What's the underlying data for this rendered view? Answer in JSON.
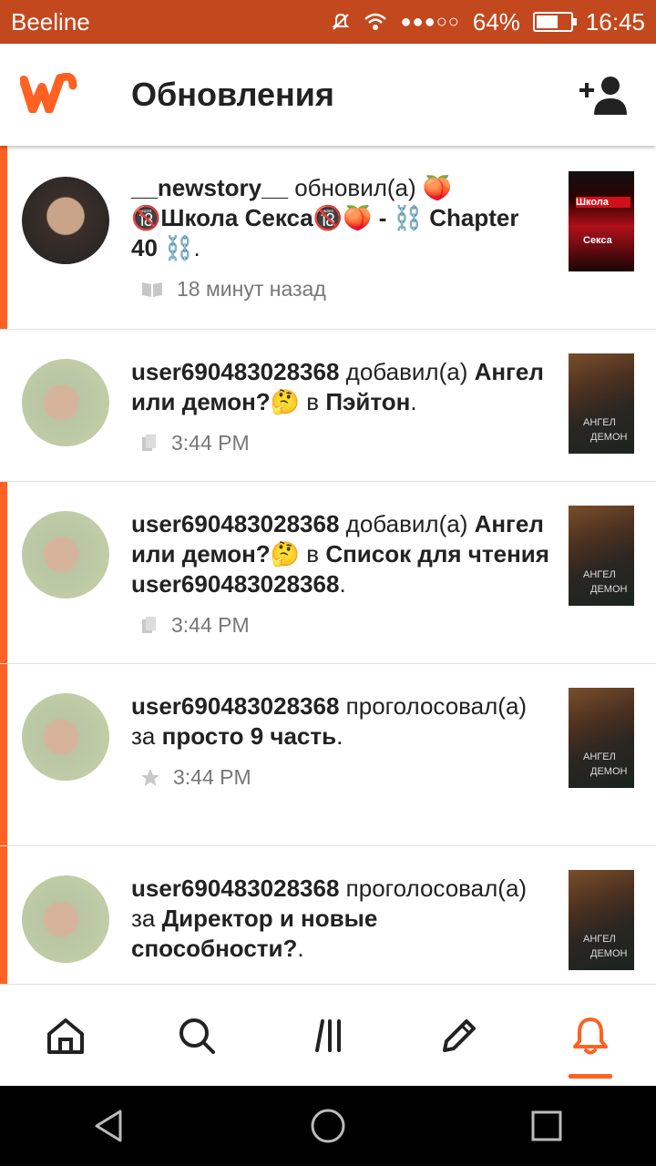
{
  "status_bar": {
    "carrier": "Beeline",
    "battery": "64%",
    "battery_level": 0.64,
    "time": "16:45"
  },
  "header": {
    "title": "Обновления"
  },
  "feed": [
    {
      "user": "__newstory__",
      "action": " обновил(а) 🍑",
      "target": "🔞Школа Секса🔞🍑 - ⛓️ Chapter 40 ⛓️",
      "suffix": ".",
      "meta_icon": "book-icon",
      "time": "18 минут назад",
      "cover_text_1": "Школа",
      "cover_text_2": "Секса",
      "unread": true
    },
    {
      "user": "user690483028368",
      "action": " добавил(а) ",
      "target": "Ангел или демон?🤔",
      "middle": " в ",
      "list": "Пэйтон",
      "suffix": ".",
      "meta_icon": "reading-list-icon",
      "time": "3:44 PM",
      "cover_text_1": "АНГЕЛ",
      "cover_text_2": "ДЕМОН",
      "unread": false
    },
    {
      "user": "user690483028368",
      "action": " добавил(а) ",
      "target": "Ангел или демон?🤔",
      "middle": " в ",
      "list": "Список для чтения user690483028368",
      "suffix": ".",
      "meta_icon": "reading-list-icon",
      "time": "3:44 PM",
      "cover_text_1": "АНГЕЛ",
      "cover_text_2": "ДЕМОН",
      "unread": true
    },
    {
      "user": "user690483028368",
      "action": " проголосовал(а) за ",
      "target": "просто 9 часть",
      "suffix": ".",
      "meta_icon": "star-icon",
      "time": "3:44 PM",
      "cover_text_1": "АНГЕЛ",
      "cover_text_2": "ДЕМОН",
      "unread": true
    },
    {
      "user": "user690483028368",
      "action": " проголосовал(а) за ",
      "target": "Директор и новые способности?",
      "suffix": ".",
      "cover_text_1": "АНГЕЛ",
      "cover_text_2": "ДЕМОН",
      "unread": true
    }
  ],
  "bottom_nav": [
    "home-icon",
    "search-icon",
    "library-icon",
    "write-icon",
    "notifications-icon"
  ],
  "colors": {
    "accent": "#ff6122",
    "status_bar": "#c4481e"
  }
}
